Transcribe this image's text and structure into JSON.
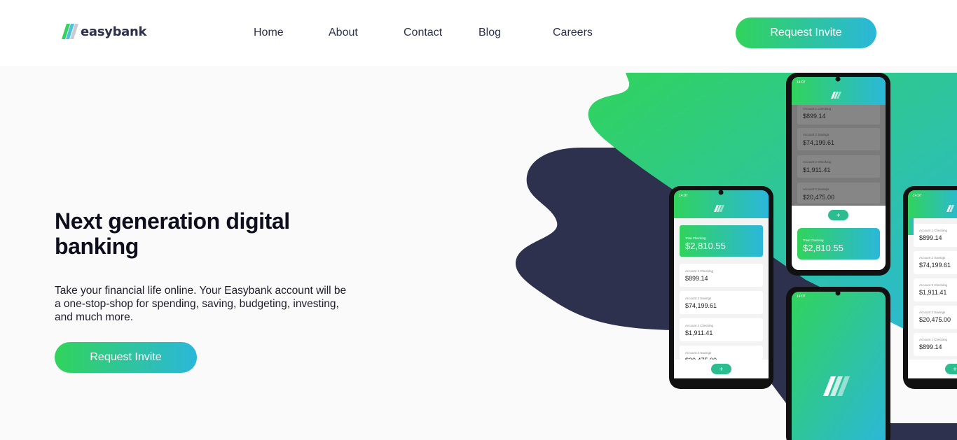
{
  "brand": {
    "name": "easybank",
    "logo_icon": "easybank-logo-icon"
  },
  "nav": {
    "items": [
      {
        "label": "Home"
      },
      {
        "label": "About"
      },
      {
        "label": "Contact"
      },
      {
        "label": "Blog"
      },
      {
        "label": "Careers"
      }
    ],
    "cta_label": "Request Invite"
  },
  "hero": {
    "title": "Next generation digital banking",
    "description": "Take your financial life online. Your Easybank account will be a one-stop-shop for spending, saving, budgeting, investing, and much more.",
    "cta_label": "Request Invite"
  },
  "phones": {
    "status_time": "14:07",
    "total_label": "Total Checking",
    "total_value": "$2,810.55",
    "accounts": [
      {
        "label": "Account 1 Checking",
        "value": "$899.14"
      },
      {
        "label": "Account 2 Savings",
        "value": "$74,199.61"
      },
      {
        "label": "Account 2 Checking",
        "value": "$1,911.41"
      },
      {
        "label": "Account 2 Savings",
        "value": "$20,475.00"
      },
      {
        "label": "Account 1 Checking",
        "value": "$899.14"
      }
    ]
  },
  "colors": {
    "dark_blue": "#2d314d",
    "lime_green": "#31d35c",
    "bright_cyan": "#2bb7da",
    "background": "#fafafa"
  }
}
